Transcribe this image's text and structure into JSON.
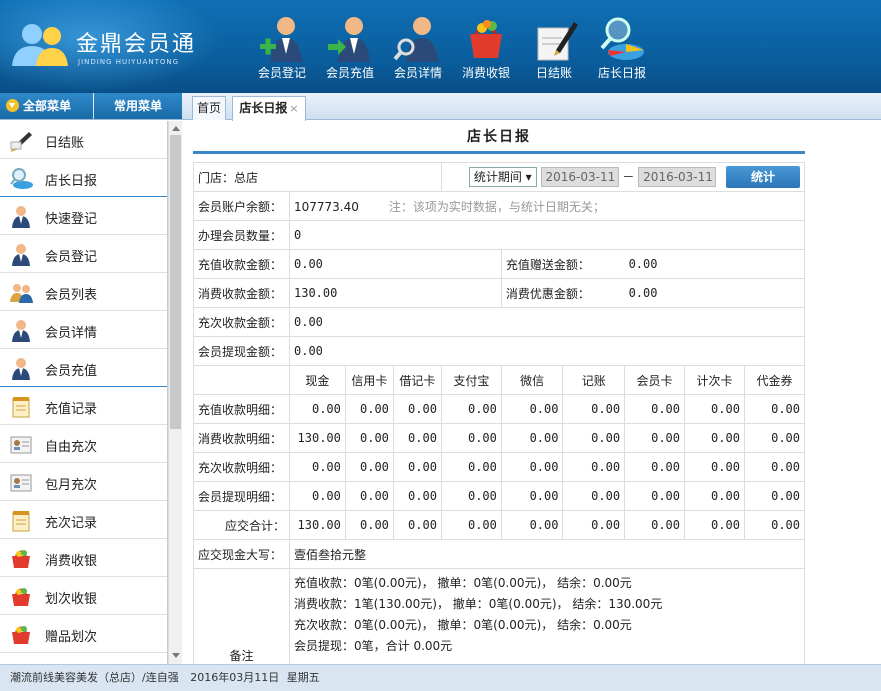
{
  "app": {
    "brand": "金鼎会员通",
    "brand_sub": "JINDING HUIYUANTONG"
  },
  "topnav": [
    {
      "label": "会员登记",
      "icon": "member-register-icon"
    },
    {
      "label": "会员充值",
      "icon": "member-recharge-icon"
    },
    {
      "label": "会员详情",
      "icon": "member-detail-icon"
    },
    {
      "label": "消费收银",
      "icon": "cashier-basket-icon"
    },
    {
      "label": "日结账",
      "icon": "daily-settle-icon"
    },
    {
      "label": "店长日报",
      "icon": "manager-report-icon"
    }
  ],
  "menu_tabs": {
    "all": "全部菜单",
    "common": "常用菜单"
  },
  "page_tabs": {
    "home": "首页",
    "daily": "店长日报",
    "close": "×"
  },
  "sidebar": [
    {
      "label": "日结账",
      "icon": "pen-icon"
    },
    {
      "label": "店长日报",
      "icon": "magnifier-chart-icon"
    },
    {
      "label": "快速登记",
      "icon": "user-icon"
    },
    {
      "label": "会员登记",
      "icon": "user-icon"
    },
    {
      "label": "会员列表",
      "icon": "users-icon"
    },
    {
      "label": "会员详情",
      "icon": "user-icon"
    },
    {
      "label": "会员充值",
      "icon": "user-icon"
    },
    {
      "label": "充值记录",
      "icon": "notepad-icon"
    },
    {
      "label": "自由充次",
      "icon": "id-card-icon"
    },
    {
      "label": "包月充次",
      "icon": "id-card-icon"
    },
    {
      "label": "充次记录",
      "icon": "notepad-icon"
    },
    {
      "label": "消费收银",
      "icon": "basket-icon"
    },
    {
      "label": "划次收银",
      "icon": "basket-icon"
    },
    {
      "label": "赠品划次",
      "icon": "basket-icon"
    }
  ],
  "report": {
    "title": "店长日报",
    "store_label": "门店：总店",
    "period_select": "统计期间",
    "date_from": "2016-03-11",
    "dash": "－",
    "date_to": "2016-03-11",
    "stat_button": "统计",
    "balance_label": "会员账户余额：",
    "balance_value": "107773.40",
    "balance_note": "注：该项为实时数据，与统计日期无关；",
    "new_members_label": "办理会员数量：",
    "new_members_value": "0",
    "recharge_label": "充值收款金额：",
    "recharge_value": "0.00",
    "recharge_gift_label": "充值赠送金额：",
    "recharge_gift_value": "0.00",
    "consume_label": "消费收款金额：",
    "consume_value": "130.00",
    "consume_discount_label": "消费优惠金额：",
    "consume_discount_value": "0.00",
    "charge_times_label": "充次收款金额：",
    "charge_times_value": "0.00",
    "withdraw_label": "会员提现金额：",
    "withdraw_value": "0.00",
    "columns": [
      "现金",
      "信用卡",
      "借记卡",
      "支付宝",
      "微信",
      "记账",
      "会员卡",
      "计次卡",
      "代金券"
    ],
    "rows": [
      {
        "label": "充值收款明细：",
        "values": [
          "0.00",
          "0.00",
          "0.00",
          "0.00",
          "0.00",
          "0.00",
          "0.00",
          "0.00",
          "0.00"
        ]
      },
      {
        "label": "消费收款明细：",
        "values": [
          "130.00",
          "0.00",
          "0.00",
          "0.00",
          "0.00",
          "0.00",
          "0.00",
          "0.00",
          "0.00"
        ]
      },
      {
        "label": "充次收款明细：",
        "values": [
          "0.00",
          "0.00",
          "0.00",
          "0.00",
          "0.00",
          "0.00",
          "0.00",
          "0.00",
          "0.00"
        ]
      },
      {
        "label": "会员提现明细：",
        "values": [
          "0.00",
          "0.00",
          "0.00",
          "0.00",
          "0.00",
          "0.00",
          "0.00",
          "0.00",
          "0.00"
        ]
      },
      {
        "label": "应交合计：",
        "values": [
          "130.00",
          "0.00",
          "0.00",
          "0.00",
          "0.00",
          "0.00",
          "0.00",
          "0.00",
          "0.00"
        ]
      }
    ],
    "cash_upper_label": "应交现金大写：",
    "cash_upper_value": "壹佰叁拾元整",
    "remarks_label": "备注",
    "remarks": [
      "充值收款：0笔(0.00元)， 撤单：0笔(0.00元)， 结余：0.00元",
      "消费收款：1笔(130.00元)， 撤单：0笔(0.00元)， 结余：130.00元",
      "充次收款：0笔(0.00元)， 撤单：0笔(0.00元)， 结余：0.00元",
      "会员提现：0笔，合计 0.00元"
    ]
  },
  "footer": {
    "user": "潮流前线美容美发（总店）/连自强",
    "date": "2016年03月11日",
    "weekday": "星期五"
  },
  "colors": {
    "header": "#0b5f9f",
    "accent": "#3b86c4"
  }
}
